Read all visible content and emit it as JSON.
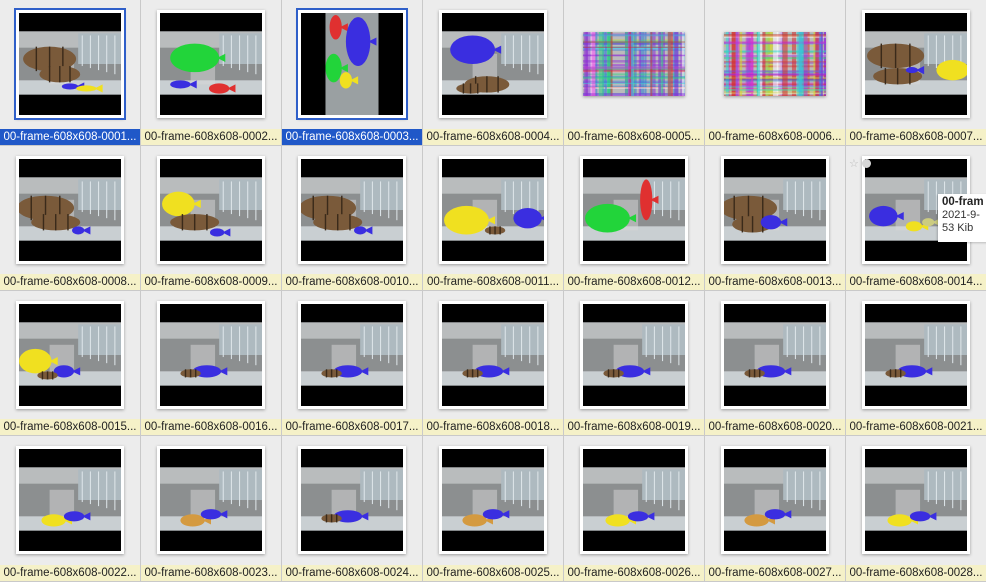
{
  "items": [
    {
      "label": "00-frame-608x608-0001...",
      "selected": true,
      "variant": "b1"
    },
    {
      "label": "00-frame-608x608-0002...",
      "selected": false,
      "variant": "g1"
    },
    {
      "label": "00-frame-608x608-0003...",
      "selected": true,
      "variant": "v1"
    },
    {
      "label": "00-frame-608x608-0004...",
      "selected": false,
      "variant": "b2"
    },
    {
      "label": "00-frame-608x608-0005...",
      "selected": false,
      "variant": "n1"
    },
    {
      "label": "00-frame-608x608-0006...",
      "selected": false,
      "variant": "n2"
    },
    {
      "label": "00-frame-608x608-0007...",
      "selected": false,
      "variant": "y1"
    },
    {
      "label": "00-frame-608x608-0008...",
      "selected": false,
      "variant": "b3"
    },
    {
      "label": "00-frame-608x608-0009...",
      "selected": false,
      "variant": "y2"
    },
    {
      "label": "00-frame-608x608-0010...",
      "selected": false,
      "variant": "b3"
    },
    {
      "label": "00-frame-608x608-0011...",
      "selected": false,
      "variant": "y3"
    },
    {
      "label": "00-frame-608x608-0012...",
      "selected": false,
      "variant": "g2"
    },
    {
      "label": "00-frame-608x608-0013...",
      "selected": false,
      "variant": "b4"
    },
    {
      "label": "00-frame-608x608-0014...",
      "selected": false,
      "variant": "b5"
    },
    {
      "label": "00-frame-608x608-0015...",
      "selected": false,
      "variant": "y4"
    },
    {
      "label": "00-frame-608x608-0016...",
      "selected": false,
      "variant": "b6"
    },
    {
      "label": "00-frame-608x608-0017...",
      "selected": false,
      "variant": "b6"
    },
    {
      "label": "00-frame-608x608-0018...",
      "selected": false,
      "variant": "b6"
    },
    {
      "label": "00-frame-608x608-0019...",
      "selected": false,
      "variant": "b6"
    },
    {
      "label": "00-frame-608x608-0020...",
      "selected": false,
      "variant": "b6"
    },
    {
      "label": "00-frame-608x608-0021...",
      "selected": false,
      "variant": "b6"
    },
    {
      "label": "00-frame-608x608-0022...",
      "selected": false,
      "variant": "y5"
    },
    {
      "label": "00-frame-608x608-0023...",
      "selected": false,
      "variant": "o1"
    },
    {
      "label": "00-frame-608x608-0024...",
      "selected": false,
      "variant": "b6"
    },
    {
      "label": "00-frame-608x608-0025...",
      "selected": false,
      "variant": "o1"
    },
    {
      "label": "00-frame-608x608-0026...",
      "selected": false,
      "variant": "y5"
    },
    {
      "label": "00-frame-608x608-0027...",
      "selected": false,
      "variant": "o1"
    },
    {
      "label": "00-frame-608x608-0028...",
      "selected": false,
      "variant": "y5"
    }
  ],
  "tooltip": {
    "title": "00-fram",
    "date": "2021-9-",
    "size": "53 Kib"
  },
  "colors": {
    "selection": "#2058c8",
    "label_bg": "#f5f1c8",
    "mask_blue": "#3a2ee0",
    "mask_green": "#22d43a",
    "mask_red": "#e03030",
    "mask_yellow": "#f0e020"
  }
}
